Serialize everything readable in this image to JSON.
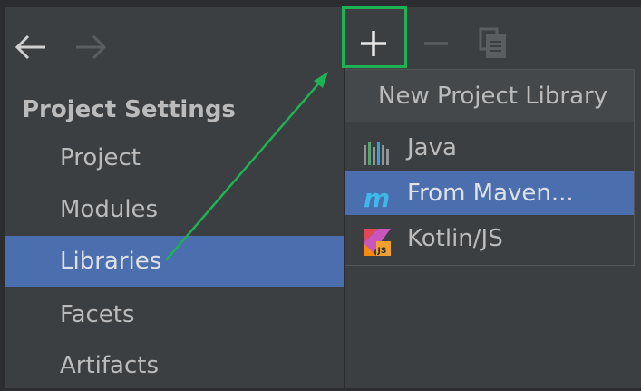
{
  "window": {
    "section_title": "Project Settings"
  },
  "nav": {
    "back_icon": "arrow-left-icon",
    "forward_icon": "arrow-right-icon",
    "items": [
      {
        "label": "Project",
        "selected": false
      },
      {
        "label": "Modules",
        "selected": false
      },
      {
        "label": "Libraries",
        "selected": true
      },
      {
        "label": "Facets",
        "selected": false
      },
      {
        "label": "Artifacts",
        "selected": false
      }
    ]
  },
  "toolbar": {
    "add_icon": "plus-icon",
    "remove_icon": "minus-icon",
    "copy_icon": "copy-icon"
  },
  "popup": {
    "header": "New Project Library",
    "items": [
      {
        "label": "Java",
        "icon": "java-library-icon",
        "selected": false
      },
      {
        "label": "From Maven...",
        "icon": "maven-icon",
        "selected": true
      },
      {
        "label": "Kotlin/JS",
        "icon": "kotlin-js-icon",
        "selected": false
      }
    ]
  },
  "colors": {
    "background": "#3c3f41",
    "selection": "#4b6eaf",
    "annotation": "#1fb255"
  }
}
